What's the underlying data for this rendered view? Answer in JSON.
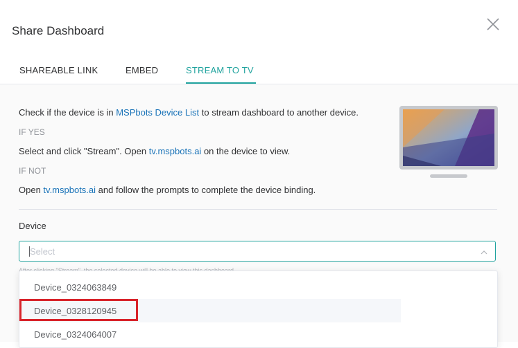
{
  "dialog": {
    "title": "Share Dashboard",
    "close_icon": "close-icon"
  },
  "tabs": [
    {
      "label": "SHAREABLE LINK",
      "active": false
    },
    {
      "label": "EMBED",
      "active": false
    },
    {
      "label": "STREAM TO TV",
      "active": true
    }
  ],
  "accent_color": "#20a39e",
  "link_color": "#1a73b8",
  "stream": {
    "line1_pre": "Check if the device is in ",
    "line1_link": "MSPbots Device List",
    "line1_post": " to stream dashboard to another device.",
    "if_yes": "IF YES",
    "line2_pre": "Select and click \"Stream\". Open ",
    "line2_link": "tv.mspbots.ai",
    "line2_post": " on the device to view.",
    "if_not": "IF NOT",
    "line3_pre": "Open ",
    "line3_link": "tv.mspbots.ai",
    "line3_post": " and follow the prompts to complete the device binding.",
    "tv_icon": "tv-illustration"
  },
  "device": {
    "label": "Device",
    "placeholder": "Select",
    "hint": "After clicking \"Stream\", the selected device will be able to view this dashboard.",
    "options": [
      "Device_0324063849",
      "Device_0328120945",
      "Device_0324064007"
    ],
    "highlighted_option": "Device_0328120945",
    "highlight_color": "#d8232a"
  }
}
